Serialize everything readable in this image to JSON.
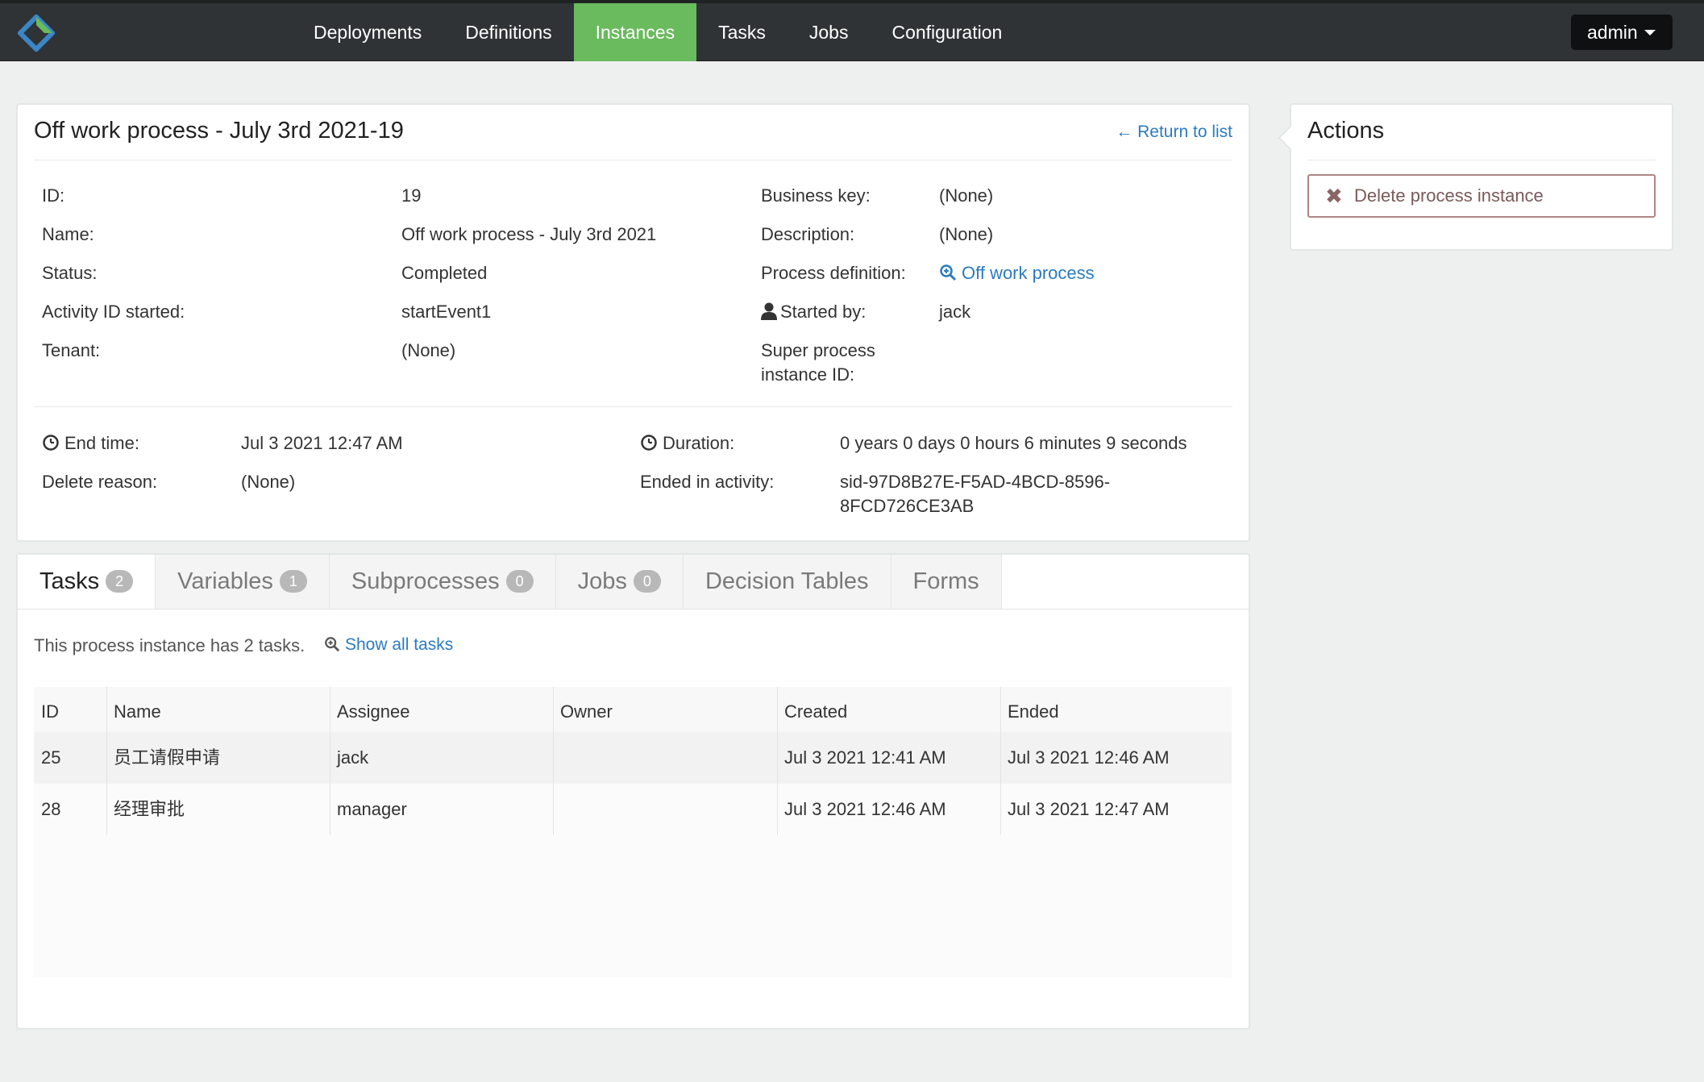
{
  "navbar": {
    "items": [
      {
        "label": "Deployments"
      },
      {
        "label": "Definitions"
      },
      {
        "label": "Instances"
      },
      {
        "label": "Tasks"
      },
      {
        "label": "Jobs"
      },
      {
        "label": "Configuration"
      }
    ],
    "active_item": "Instances",
    "user_label": "admin"
  },
  "details": {
    "title": "Off work process - July 3rd 2021-19",
    "return_link": "← Return to list",
    "left": [
      {
        "label": "ID:",
        "value": "19"
      },
      {
        "label": "Name:",
        "value": "Off work process - July 3rd 2021"
      },
      {
        "label": "Status:",
        "value": "Completed"
      },
      {
        "label": "Activity ID started:",
        "value": "startEvent1"
      },
      {
        "label": "Tenant:",
        "value": "(None)"
      }
    ],
    "right": [
      {
        "label": "Business key:",
        "value": "(None)"
      },
      {
        "label": "Description:",
        "value": "(None)"
      },
      {
        "label": "Process definition:",
        "value": "Off work process"
      },
      {
        "label": "Started by:",
        "value": "jack"
      },
      {
        "label_line1": "Super process",
        "label_line2": "instance ID:",
        "value": ""
      }
    ],
    "end_time_label": "End time:",
    "end_time_value": "Jul 3 2021 12:47 AM",
    "delete_reason_label": "Delete reason:",
    "delete_reason_value": "(None)",
    "duration_label": "Duration:",
    "duration_value": "0 years 0 days 0 hours 6 minutes 9 seconds",
    "ended_activity_label": "Ended in activity:",
    "ended_activity_line1": "sid-97D8B27E-F5AD-4BCD-8596-",
    "ended_activity_line2": "8FCD726CE3AB"
  },
  "actions": {
    "title": "Actions",
    "delete_label": "Delete process instance"
  },
  "tabs": [
    {
      "label": "Tasks",
      "count": "2"
    },
    {
      "label": "Variables",
      "count": "1"
    },
    {
      "label": "Subprocesses",
      "count": "0"
    },
    {
      "label": "Jobs",
      "count": "0"
    },
    {
      "label": "Decision Tables",
      "count": ""
    },
    {
      "label": "Forms",
      "count": ""
    }
  ],
  "tasks": {
    "summary": "This process instance has 2 tasks.",
    "show_all": "Show all tasks",
    "columns": [
      "ID",
      "Name",
      "Assignee",
      "Owner",
      "Created",
      "Ended"
    ],
    "rows": [
      [
        "25",
        "员工请假申请",
        "jack",
        "",
        "Jul 3 2021 12:41 AM",
        "Jul 3 2021 12:46 AM"
      ],
      [
        "28",
        "经理审批",
        "manager",
        "",
        "Jul 3 2021 12:46 AM",
        "Jul 3 2021 12:47 AM"
      ]
    ]
  },
  "colors": {
    "navbar": "#2f3335",
    "active_tab": "#6aba5e",
    "link": "#2b7bbf"
  }
}
